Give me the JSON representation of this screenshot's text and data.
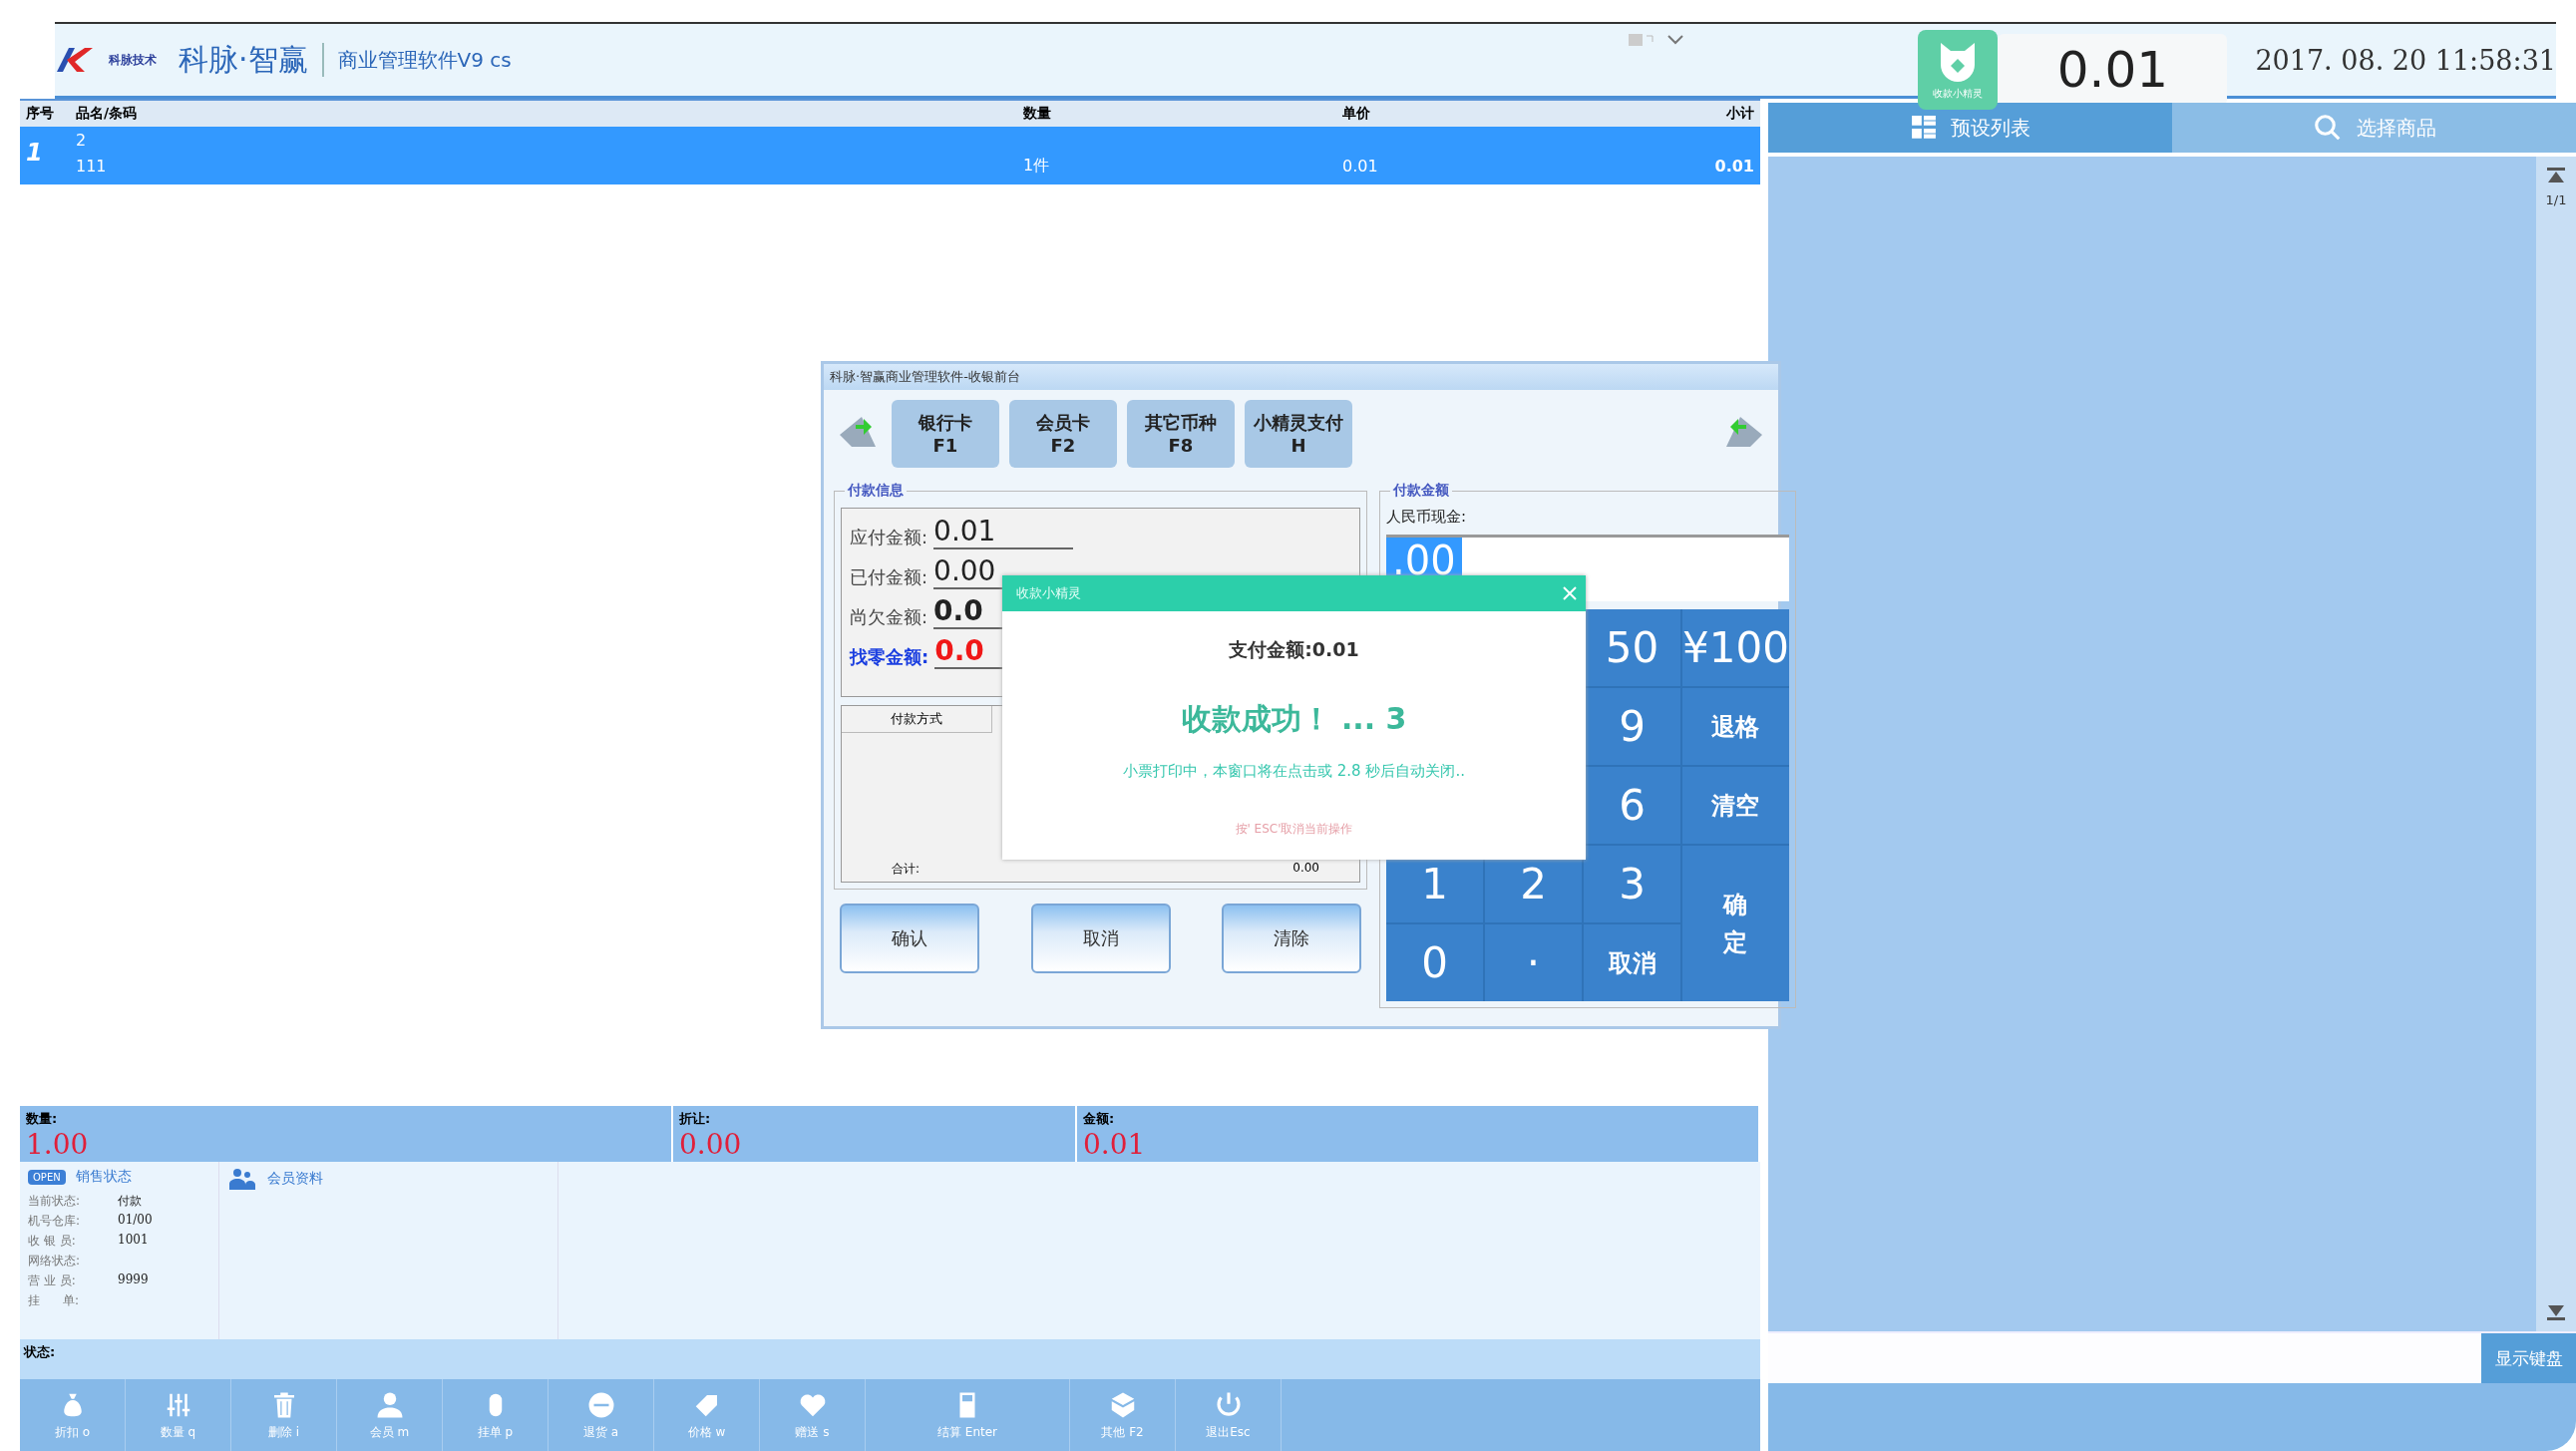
{
  "header": {
    "brand_small": "科脉技术",
    "brand": "科脉·智赢",
    "product": "商业管理软件V9 cs",
    "badge_label": "收款小精灵",
    "amount": "0.01",
    "datetime": "2017. 08. 20  11:58:31"
  },
  "table": {
    "columns": [
      "序号",
      "品名/条码",
      "数量",
      "单价",
      "小计"
    ],
    "rows": [
      {
        "index": "1",
        "name": "2",
        "code": "111",
        "qty": "1件",
        "price": "0.01",
        "subtotal": "0.01",
        "selected": true
      }
    ]
  },
  "summary": [
    {
      "label": "数量:",
      "value": "1.00"
    },
    {
      "label": "折让:",
      "value": "0.00"
    },
    {
      "label": "金额:",
      "value": "0.01"
    }
  ],
  "sales_status": {
    "title": "销售状态",
    "badge": "OPEN",
    "fields": [
      {
        "label": "当前状态:",
        "value": "付款"
      },
      {
        "label": "机号仓库:",
        "value": "01/00"
      },
      {
        "label": "收 银 员:",
        "value": "1001"
      },
      {
        "label": "网络状态:"
      },
      {
        "label": "营 业 员:",
        "value": "9999"
      },
      {
        "label": "挂      单:"
      }
    ]
  },
  "member": {
    "title": "会员资料"
  },
  "status_bar": {
    "label": "状态:"
  },
  "toolbar": [
    {
      "label": "折扣 o"
    },
    {
      "label": "数量 q"
    },
    {
      "label": "删除 i"
    },
    {
      "label": "会员 m"
    },
    {
      "label": "挂单 p"
    },
    {
      "label": "退货 a"
    },
    {
      "label": "价格 w"
    },
    {
      "label": "赠送 s"
    },
    {
      "label": "结算 Enter"
    },
    {
      "label": "其他 F2"
    },
    {
      "label": "退出Esc"
    }
  ],
  "right_panel": {
    "tabs": [
      {
        "label": "预设列表",
        "selected": true
      },
      {
        "label": "选择商品",
        "selected": false
      }
    ],
    "page": "1/1",
    "keyboard_button": "显示键盘"
  },
  "payment_dialog": {
    "title": "科脉·智赢商业管理软件-收银前台",
    "methods": [
      {
        "name": "银行卡",
        "key": "F1"
      },
      {
        "name": "会员卡",
        "key": "F2"
      },
      {
        "name": "其它币种",
        "key": "F8"
      },
      {
        "name": "小精灵支付",
        "key": "H"
      }
    ],
    "info_title": "付款信息",
    "info": [
      {
        "label": "应付金额:",
        "value": "0.01",
        "kind": "normal"
      },
      {
        "label": "已付金额:",
        "value": "0.00",
        "kind": "normal"
      },
      {
        "label": "尚欠金额:",
        "value": "0.0",
        "kind": "bold"
      },
      {
        "label": "找零金额:",
        "value": "0.0",
        "kind": "change"
      }
    ],
    "pay_table": {
      "column": "付款方式",
      "total_label": "合计:",
      "total": "0.00"
    },
    "buttons": [
      "确认",
      "取消",
      "清除"
    ],
    "amount_title": "付款金额",
    "cash_label": "人民币现金:",
    "cash_value": ".00",
    "keypad": [
      {
        "kind": "hidden"
      },
      {
        "kind": "hidden"
      },
      {
        "label": "50",
        "kind": "key"
      },
      {
        "label": "¥100",
        "kind": "key"
      },
      {
        "kind": "hidden"
      },
      {
        "kind": "hidden"
      },
      {
        "label": "9",
        "kind": "key"
      },
      {
        "label": "退格",
        "kind": "action"
      },
      {
        "kind": "hidden"
      },
      {
        "kind": "hidden"
      },
      {
        "label": "6",
        "kind": "key"
      },
      {
        "label": "清空",
        "kind": "action"
      },
      {
        "label": "1",
        "kind": "key"
      },
      {
        "label": "2",
        "kind": "key"
      },
      {
        "label": "3",
        "kind": "key"
      },
      {
        "label": "确定",
        "kind": "confirm"
      },
      {
        "label": "0",
        "kind": "key"
      },
      {
        "label": "·",
        "kind": "key"
      },
      {
        "label": "取消",
        "kind": "action"
      }
    ]
  },
  "success_popup": {
    "title": "收款小精灵",
    "amount": "支付金额:0.01",
    "message": "收款成功！ ... 3",
    "note": "小票打印中，本窗口将在点击或 2.8 秒后自动关闭..",
    "hint": "按' ESC'取消当前操作"
  }
}
